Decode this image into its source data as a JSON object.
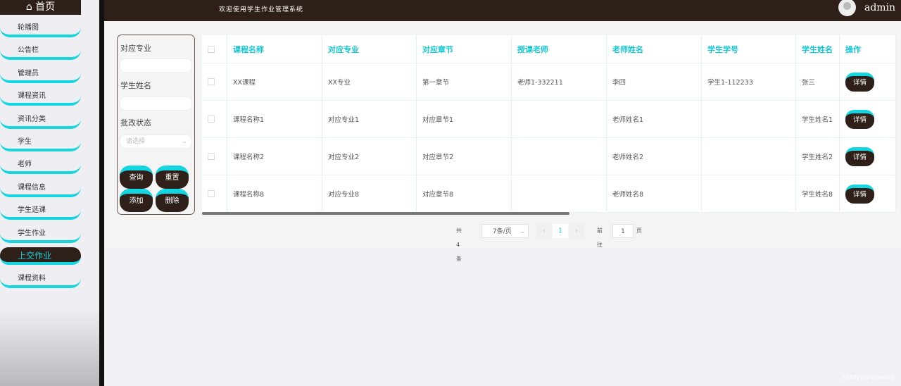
{
  "sidebar": {
    "home": "首页",
    "items": [
      "轮播图",
      "公告栏",
      "管理员",
      "课程资讯",
      "资讯分类",
      "学生",
      "老师",
      "课程信息",
      "学生选课",
      "学生作业",
      "上交作业",
      "课程资料"
    ],
    "active": "上交作业"
  },
  "header": {
    "welcome": "欢迎使用学生作业管理系统",
    "user": "admin"
  },
  "filter": {
    "major_label": "对应专业",
    "name_label": "学生姓名",
    "status_label": "批改状态",
    "status_placeholder": "请选择",
    "query": "查询",
    "reset": "重置",
    "add": "添加",
    "delete": "删除"
  },
  "table": {
    "headers": [
      "课程名称",
      "对应专业",
      "对应章节",
      "授课老师",
      "老师姓名",
      "学生学号",
      "学生姓名",
      "操作"
    ],
    "rows": [
      [
        "XX课程",
        "XX专业",
        "第一章节",
        "老师1-332211",
        "李四",
        "学生1-112233",
        "张三"
      ],
      [
        "课程名称1",
        "对应专业1",
        "对应章节1",
        "",
        "老师姓名1",
        "",
        "学生姓名1"
      ],
      [
        "课程名称2",
        "对应专业2",
        "对应章节2",
        "",
        "老师姓名2",
        "",
        "学生姓名2"
      ],
      [
        "课程名称8",
        "对应专业8",
        "对应章节8",
        "",
        "老师姓名8",
        "",
        "学生姓名8"
      ]
    ],
    "detail": "详情"
  },
  "pager": {
    "total": "共 4 条",
    "size": "7条/页",
    "page": "1",
    "goto": "前往",
    "goto_value": "1",
    "page_unit": "页"
  },
  "watermark": "CSDN @yuyuxun1",
  "colors": {
    "accent": "#14d6e0",
    "dark": "#2e1f18"
  }
}
